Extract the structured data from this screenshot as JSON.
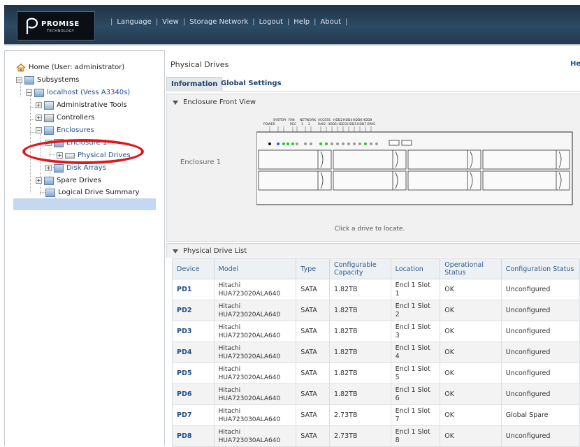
{
  "header": {
    "logo": {
      "brand": "PROMISE",
      "sub": "TECHNOLOGY"
    },
    "nav": [
      "Language",
      "View",
      "Storage Network",
      "Logout",
      "Help",
      "About"
    ]
  },
  "tree": {
    "items": [
      {
        "label": "Home (User: administrator)",
        "icon": "home-icon"
      },
      {
        "label": "Subsystems",
        "icon": "subsystems-icon"
      },
      {
        "label": "localhost (Vess A3340s)",
        "icon": "server-icon"
      },
      {
        "label": "Administrative Tools",
        "icon": "tools-icon"
      },
      {
        "label": "Controllers",
        "icon": "controller-icon"
      },
      {
        "label": "Enclosures",
        "icon": "enclosure-icon"
      },
      {
        "label": "Enclosure 1",
        "icon": "enclosure-icon"
      },
      {
        "label": "Physical Drives",
        "icon": "physical-drive-icon"
      },
      {
        "label": "Disk Arrays",
        "icon": "disk-array-icon"
      },
      {
        "label": "Spare Drives",
        "icon": "spare-drive-icon"
      },
      {
        "label": "Logical Drive Summary",
        "icon": "logical-drive-icon"
      }
    ],
    "selected": "Physical Drives"
  },
  "main": {
    "title": "Physical Drives",
    "help": "He",
    "tabs": [
      "Information",
      "Global Settings"
    ],
    "active_tab": "Information",
    "enclosure_view": {
      "heading": "Enclosure Front View",
      "enclosure_label": "Enclosure 1",
      "hint": "Click a drive to locate.",
      "indicators_top": [
        "SYSTEM",
        "FAN",
        "NETWORK",
        "ACCESS",
        "HDD2",
        "HDD4",
        "HDD6",
        "HDD8"
      ],
      "indicators_bottom": [
        "POWER",
        "REC",
        "1",
        "2",
        "RAID",
        "HDD1",
        "HDD3",
        "HDD5",
        "HDD7",
        "OPAS"
      ],
      "drive_bay_count": 8
    },
    "list": {
      "heading": "Physical Drive List",
      "columns": [
        "Device",
        "Model",
        "Type",
        "Configurable Capacity",
        "Location",
        "Operational Status",
        "Configuration Status"
      ],
      "rows": [
        {
          "device": "PD1",
          "model_line1": "Hitachi",
          "model_line2": "HUA723020ALA640",
          "type": "SATA",
          "capacity": "1.82TB",
          "location": "Encl 1 Slot 1",
          "op_status": "OK",
          "config_status": "Unconfigured"
        },
        {
          "device": "PD2",
          "model_line1": "Hitachi",
          "model_line2": "HUA723020ALA640",
          "type": "SATA",
          "capacity": "1.82TB",
          "location": "Encl 1 Slot 2",
          "op_status": "OK",
          "config_status": "Unconfigured"
        },
        {
          "device": "PD3",
          "model_line1": "Hitachi",
          "model_line2": "HUA723020ALA640",
          "type": "SATA",
          "capacity": "1.82TB",
          "location": "Encl 1 Slot 3",
          "op_status": "OK",
          "config_status": "Unconfigured"
        },
        {
          "device": "PD4",
          "model_line1": "Hitachi",
          "model_line2": "HUA723020ALA640",
          "type": "SATA",
          "capacity": "1.82TB",
          "location": "Encl 1 Slot 4",
          "op_status": "OK",
          "config_status": "Unconfigured"
        },
        {
          "device": "PD5",
          "model_line1": "Hitachi",
          "model_line2": "HUA723020ALA640",
          "type": "SATA",
          "capacity": "1.82TB",
          "location": "Encl 1 Slot 5",
          "op_status": "OK",
          "config_status": "Unconfigured"
        },
        {
          "device": "PD6",
          "model_line1": "Hitachi",
          "model_line2": "HUA723020ALA640",
          "type": "SATA",
          "capacity": "1.82TB",
          "location": "Encl 1 Slot 6",
          "op_status": "OK",
          "config_status": "Unconfigured"
        },
        {
          "device": "PD7",
          "model_line1": "Hitachi",
          "model_line2": "HUA723030ALA640",
          "type": "SATA",
          "capacity": "2.73TB",
          "location": "Encl 1 Slot 7",
          "op_status": "OK",
          "config_status": "Global Spare"
        },
        {
          "device": "PD8",
          "model_line1": "Hitachi",
          "model_line2": "HUA723030ALA640",
          "type": "SATA",
          "capacity": "2.73TB",
          "location": "Encl 1 Slot 8",
          "op_status": "OK",
          "config_status": "Unconfigured"
        }
      ]
    }
  },
  "colors": {
    "header_bg": "#2d4a63",
    "link_blue": "#1f4f8a",
    "selection": "#c4d9ef",
    "annotation_red": "#e2171c",
    "led_green": "#2fbf2f",
    "led_blue": "#2a63c9"
  }
}
